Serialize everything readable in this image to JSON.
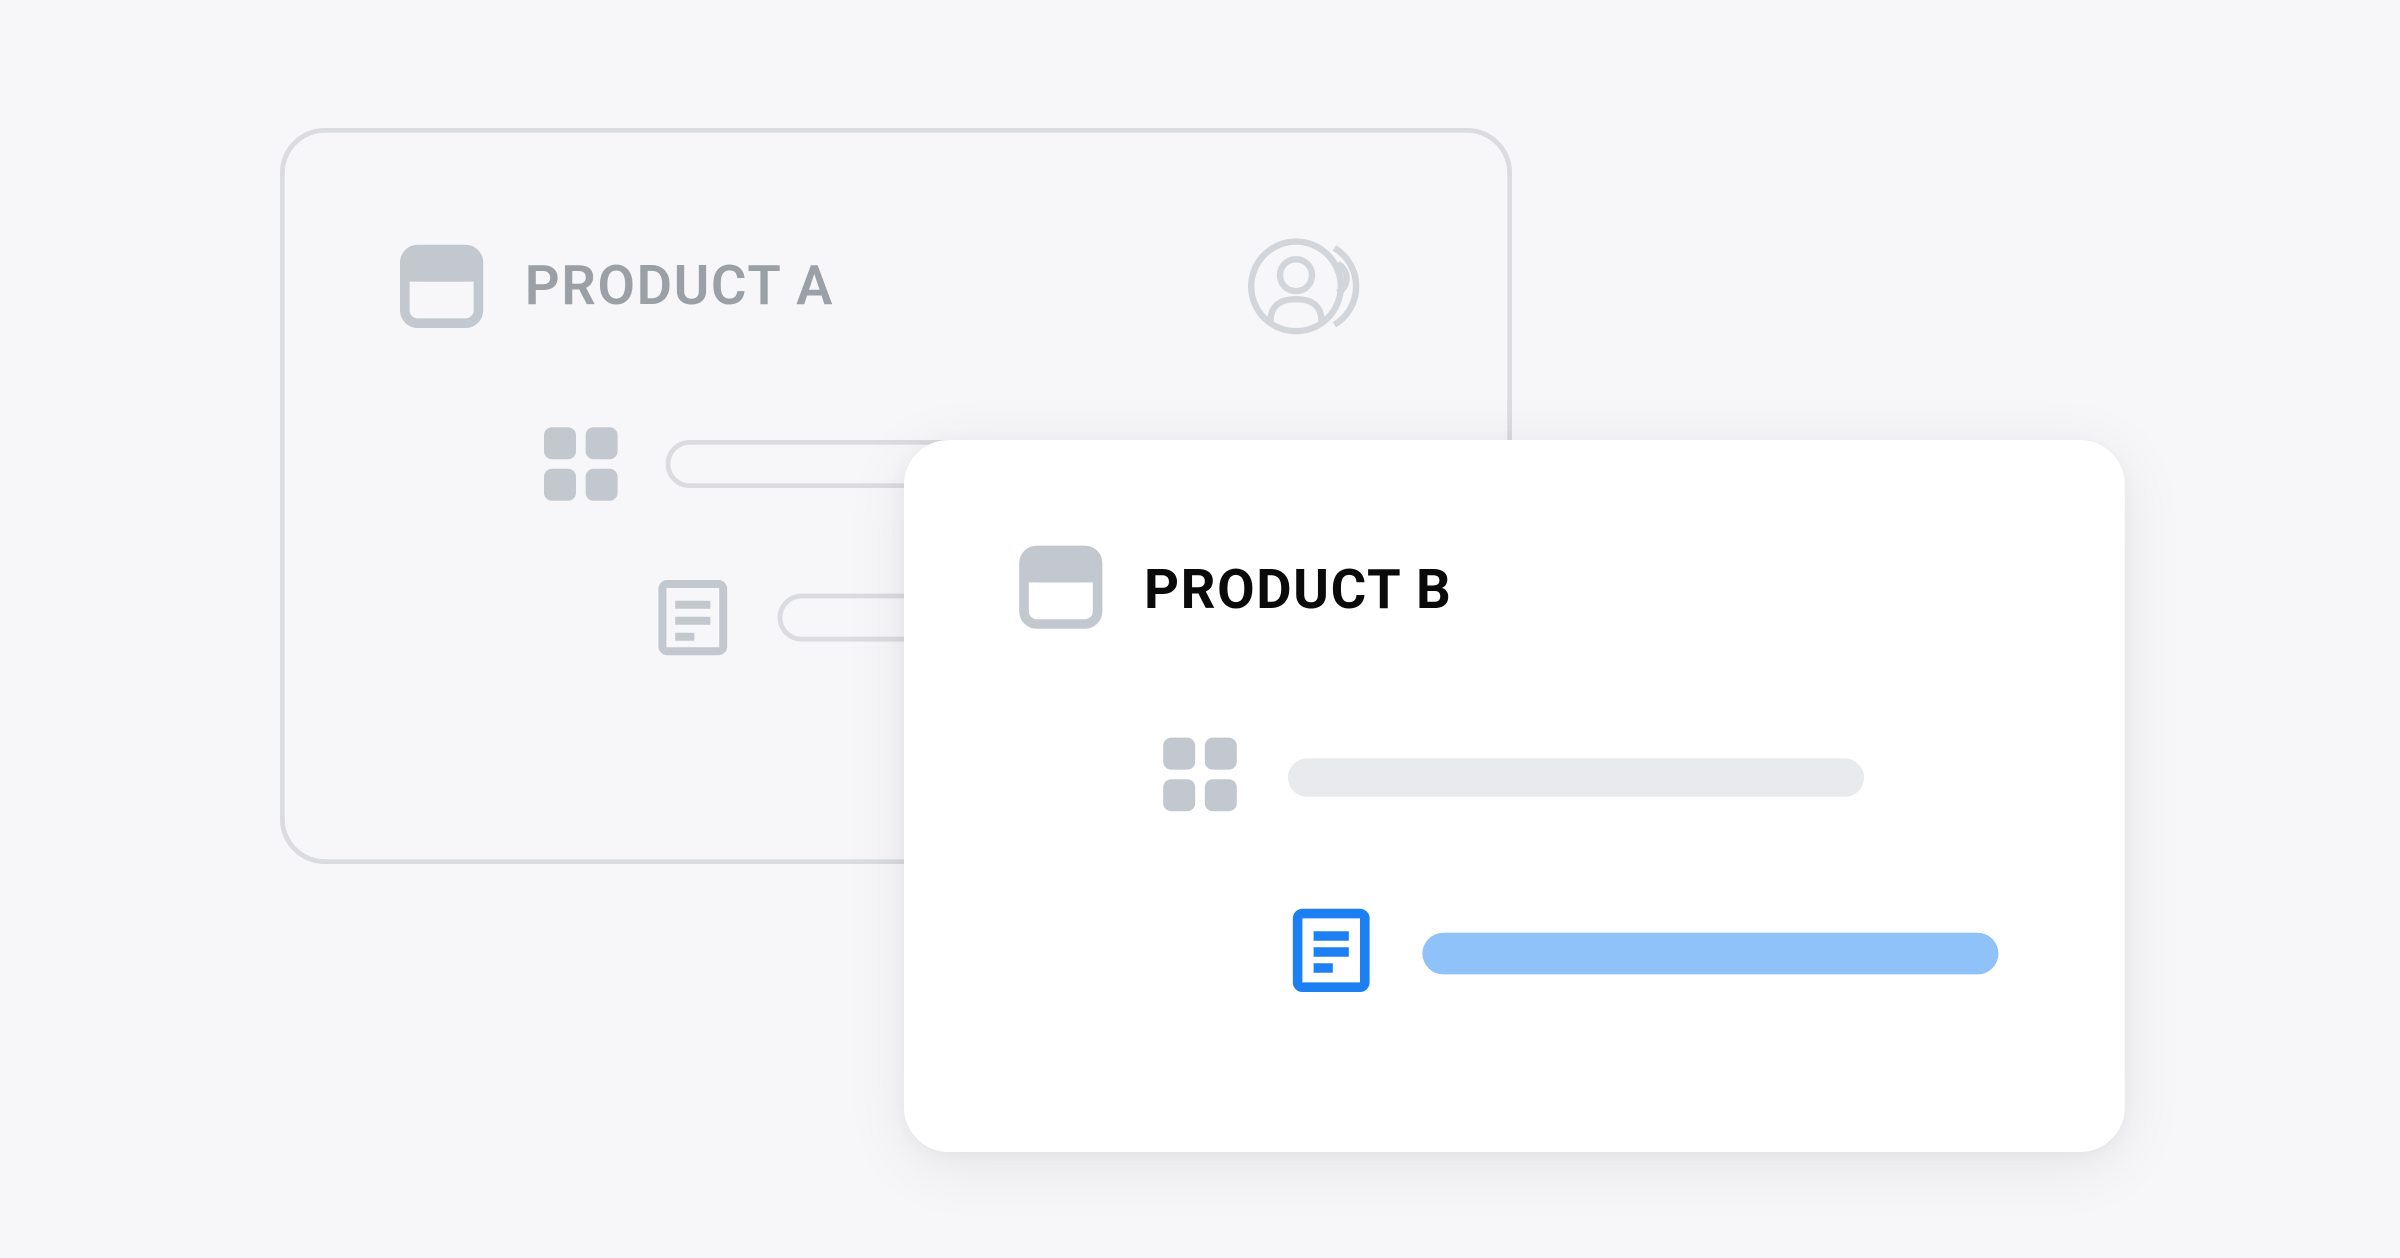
{
  "cardA": {
    "title": "PRODUCT A"
  },
  "cardB": {
    "title": "PRODUCT B"
  },
  "colors": {
    "ghostBorder": "#dadce0",
    "ghostText": "#9aa0a6",
    "foregroundText": "#0a0a0a",
    "accentBlue": "#1c7ff2",
    "accentBlueLight": "#8ec2f8",
    "iconGrey": "#c3c8cf",
    "pillGrey": "#e8eaed"
  }
}
